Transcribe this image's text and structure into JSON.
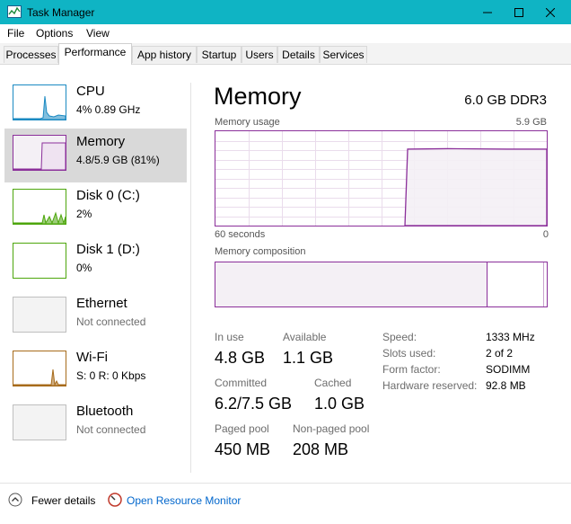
{
  "window": {
    "title": "Task Manager"
  },
  "menu": {
    "file": "File",
    "options": "Options",
    "view": "View"
  },
  "tabs": [
    "Processes",
    "Performance",
    "App history",
    "Startup",
    "Users",
    "Details",
    "Services"
  ],
  "active_tab": "Performance",
  "sidebar": [
    {
      "name": "CPU",
      "sub": "4%  0.89 GHz",
      "color": "#1b8ac2",
      "kind": "cpu"
    },
    {
      "name": "Memory",
      "sub": "4.8/5.9 GB (81%)",
      "color": "#8b2f9a",
      "kind": "mem"
    },
    {
      "name": "Disk 0 (C:)",
      "sub": "2%",
      "color": "#4da60c",
      "kind": "disk"
    },
    {
      "name": "Disk 1 (D:)",
      "sub": "0%",
      "color": "#4da60c",
      "kind": "disk-empty"
    },
    {
      "name": "Ethernet",
      "sub": "Not connected",
      "color": "#bfbfbf",
      "kind": "empty"
    },
    {
      "name": "Wi-Fi",
      "sub": "S: 0  R: 0 Kbps",
      "color": "#a76b1b",
      "kind": "wifi"
    },
    {
      "name": "Bluetooth",
      "sub": "Not connected",
      "color": "#bfbfbf",
      "kind": "empty"
    }
  ],
  "main": {
    "title": "Memory",
    "spec": "6.0 GB DDR3",
    "usage_label": "Memory usage",
    "usage_max": "5.9 GB",
    "time_left": "60 seconds",
    "time_right": "0",
    "composition_label": "Memory composition",
    "stats": {
      "in_use_label": "In use",
      "in_use": "4.8 GB",
      "available_label": "Available",
      "available": "1.1 GB",
      "committed_label": "Committed",
      "committed": "6.2/7.5 GB",
      "cached_label": "Cached",
      "cached": "1.0 GB",
      "paged_label": "Paged pool",
      "paged": "450 MB",
      "nonpaged_label": "Non-paged pool",
      "nonpaged": "208 MB"
    },
    "specs": [
      {
        "label": "Speed:",
        "value": "1333 MHz"
      },
      {
        "label": "Slots used:",
        "value": "2 of 2"
      },
      {
        "label": "Form factor:",
        "value": "SODIMM"
      },
      {
        "label": "Hardware reserved:",
        "value": "92.8 MB"
      }
    ],
    "accent": "#8b2f9a",
    "usage_fraction": 0.81
  },
  "footer": {
    "fewer_details": "Fewer details",
    "open_monitor": "Open Resource Monitor"
  }
}
